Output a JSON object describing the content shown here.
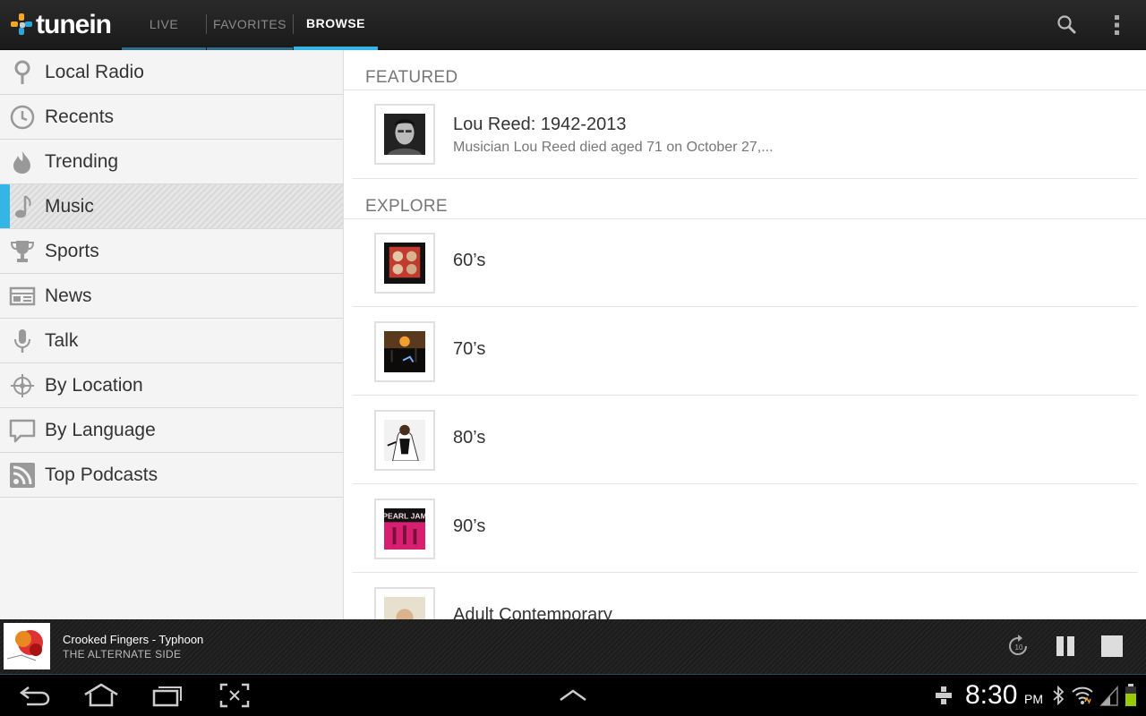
{
  "app": {
    "logo_text": "tunein",
    "tabs": [
      {
        "label": "LIVE"
      },
      {
        "label": "FAVORITES"
      },
      {
        "label": "BROWSE"
      }
    ],
    "active_tab": "BROWSE",
    "accent_color": "#33b5e5"
  },
  "sidebar": {
    "items": [
      {
        "label": "Local Radio",
        "icon": "location-pin-icon"
      },
      {
        "label": "Recents",
        "icon": "clock-icon"
      },
      {
        "label": "Trending",
        "icon": "flame-icon"
      },
      {
        "label": "Music",
        "icon": "music-note-icon",
        "active": true
      },
      {
        "label": "Sports",
        "icon": "trophy-icon"
      },
      {
        "label": "News",
        "icon": "newspaper-icon"
      },
      {
        "label": "Talk",
        "icon": "microphone-icon"
      },
      {
        "label": "By Location",
        "icon": "crosshair-icon"
      },
      {
        "label": "By Language",
        "icon": "speech-bubble-icon"
      },
      {
        "label": "Top Podcasts",
        "icon": "rss-icon"
      }
    ]
  },
  "main": {
    "featured_header": "FEATURED",
    "featured": {
      "title": "Lou Reed: 1942-2013",
      "subtitle": "Musician Lou Reed died aged 71 on October 27,..."
    },
    "explore_header": "EXPLORE",
    "explore": [
      {
        "label": "60’s"
      },
      {
        "label": "70’s"
      },
      {
        "label": "80’s"
      },
      {
        "label": "90’s"
      },
      {
        "label": "Adult Contemporary"
      }
    ]
  },
  "now_playing": {
    "title": "Crooked Fingers - Typhoon",
    "station": "THE ALTERNATE SIDE"
  },
  "status_bar": {
    "time": "8:30",
    "ampm": "PM"
  }
}
